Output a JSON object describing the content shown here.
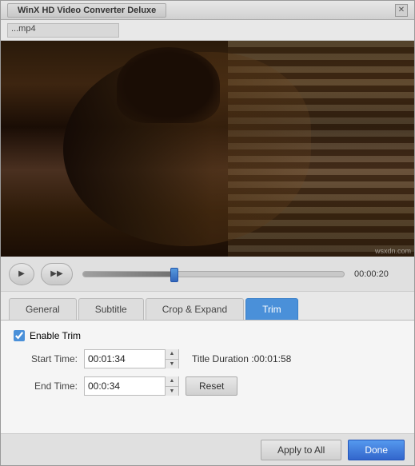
{
  "window": {
    "title": "WinX HD Video Converter Deluxe",
    "close_label": "✕"
  },
  "file_bar": {
    "filename": "mp4",
    "filename_prefix": "..."
  },
  "playback": {
    "play_label": "▶",
    "ff_label": "⏩",
    "time_display": "00:00:20"
  },
  "tabs": [
    {
      "id": "general",
      "label": "General",
      "active": false
    },
    {
      "id": "subtitle",
      "label": "Subtitle",
      "active": false
    },
    {
      "id": "crop-expand",
      "label": "Crop & Expand",
      "active": false
    },
    {
      "id": "trim",
      "label": "Trim",
      "active": true
    }
  ],
  "trim": {
    "enable_label": "Enable Trim",
    "start_label": "Start Time:",
    "start_value": "00:01:34",
    "end_label": "End Time:",
    "end_value_prefix": "00:",
    "end_value_highlight": "0",
    "end_value_suffix": ":34",
    "title_duration_label": "Title Duration :",
    "title_duration_value": "00:01:58",
    "reset_label": "Reset"
  },
  "bottom": {
    "apply_label": "Apply to All",
    "done_label": "Done"
  },
  "watermark": "wsxdn.com"
}
